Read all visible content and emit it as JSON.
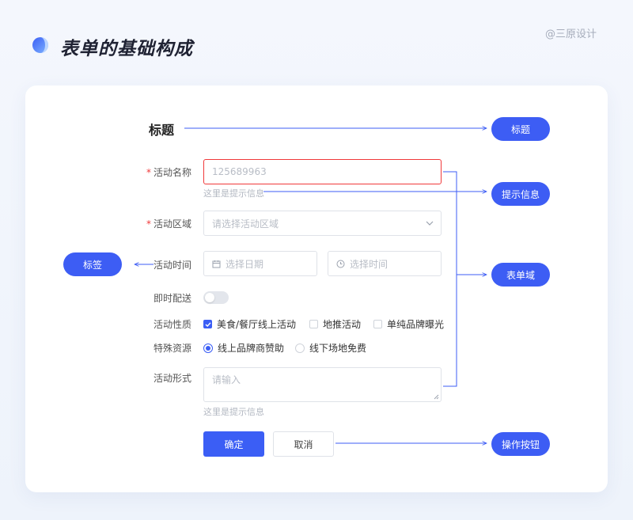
{
  "header": {
    "title": "表单的基础构成",
    "credit": "@三原设计"
  },
  "form": {
    "title": "标题",
    "fields": {
      "name": {
        "label": "活动名称",
        "value": "125689963",
        "hint": "这里是提示信息"
      },
      "region": {
        "label": "活动区域",
        "placeholder": "请选择活动区域"
      },
      "time": {
        "label": "活动时间",
        "date_placeholder": "选择日期",
        "time_placeholder": "选择时间"
      },
      "delivery": {
        "label": "即时配送",
        "enabled": false
      },
      "nature": {
        "label": "活动性质",
        "options": [
          {
            "label": "美食/餐厅线上活动",
            "checked": true
          },
          {
            "label": "地推活动",
            "checked": false
          },
          {
            "label": "单纯品牌曝光",
            "checked": false
          }
        ]
      },
      "resource": {
        "label": "特殊资源",
        "options": [
          {
            "label": "线上品牌商赞助",
            "selected": true
          },
          {
            "label": "线下场地免费",
            "selected": false
          }
        ]
      },
      "form_type": {
        "label": "活动形式",
        "placeholder": "请输入",
        "hint": "这里是提示信息"
      }
    },
    "buttons": {
      "confirm": "确定",
      "cancel": "取消"
    }
  },
  "annotations": {
    "title": "标题",
    "hint": "提示信息",
    "field_area": "表单域",
    "label": "标签",
    "actions": "操作按钮"
  },
  "colors": {
    "accent": "#3b5ef5",
    "error": "#f0393a",
    "background": "#eef3fb"
  }
}
